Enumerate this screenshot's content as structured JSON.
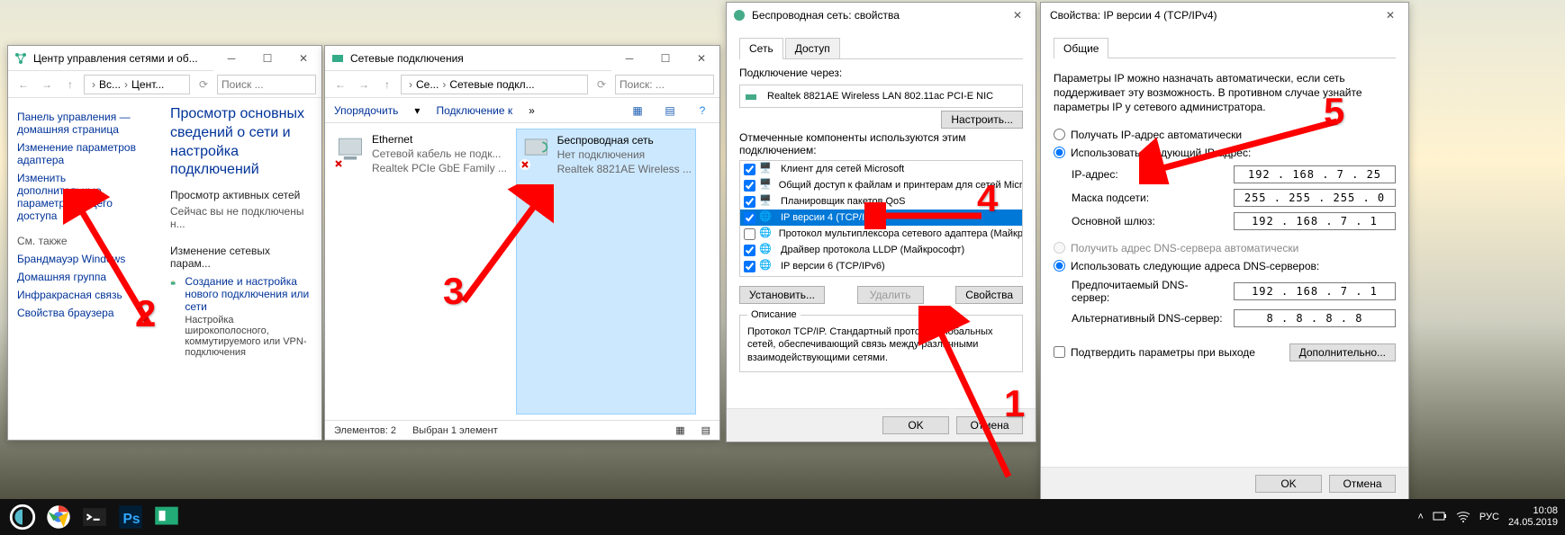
{
  "win1": {
    "title": "Центр управления сетями и об...",
    "crumb1": "Вс...",
    "crumb2": "Цент...",
    "search_ph": "Поиск ...",
    "side_home": "Панель управления — домашняя страница",
    "side_adapter": "Изменение параметров адаптера",
    "side_sharing": "Изменить дополнительные параметры общего доступа",
    "side_see_also": "См. также",
    "side_fw": "Брандмауэр Windows",
    "side_hg": "Домашняя группа",
    "side_ir": "Инфракрасная связь",
    "side_bp": "Свойства браузера",
    "main_h1": "Просмотр основных сведений о сети и настройка подключений",
    "main_active": "Просмотр активных сетей",
    "main_noconn": "Сейчас вы не подключены н...",
    "main_change": "Изменение сетевых парам...",
    "main_newconn": "Создание и настройка нового подключения или сети",
    "main_newconn_sub": "Настройка широкополосного, коммутируемого или VPN-подключения"
  },
  "win2": {
    "title": "Сетевые подключения",
    "crumb1": "Се...",
    "crumb2": "Сетевые подкл...",
    "search_ph": "Поиск: ...",
    "organize": "Упорядочить",
    "connect_to": "Подключение к",
    "eth_name": "Ethernet",
    "eth_status": "Сетевой кабель не подк...",
    "eth_dev": "Realtek PCIe GbE Family ...",
    "wifi_name": "Беспроводная сеть",
    "wifi_status": "Нет подключения",
    "wifi_dev": "Realtek 8821AE Wireless ...",
    "status_count": "Элементов: 2",
    "status_sel": "Выбран 1 элемент"
  },
  "win3": {
    "title": "Беспроводная сеть: свойства",
    "tab_net": "Сеть",
    "tab_access": "Доступ",
    "conn_via": "Подключение через:",
    "adapter": "Realtek 8821AE Wireless LAN 802.11ac PCI-E NIC",
    "configure": "Настроить...",
    "components_lbl": "Отмеченные компоненты используются этим подключением:",
    "comps": [
      "Клиент для сетей Microsoft",
      "Общий доступ к файлам и принтерам для сетей Micr...",
      "Планировщик пакетов QoS",
      "IP версии 4 (TCP/IPv4)",
      "Протокол мультиплексора сетевого адаптера (Майкро...",
      "Драйвер протокола LLDP (Майкрософт)",
      "IP версии 6 (TCP/IPv6)"
    ],
    "install": "Установить...",
    "uninstall": "Удалить",
    "props": "Свойства",
    "desc_h": "Описание",
    "desc": "Протокол TCP/IP. Стандартный протокол глобальных сетей, обеспечивающий связь между различными взаимодействующими сетями.",
    "ok": "OK",
    "cancel": "Отмена"
  },
  "win4": {
    "title": "Свойства: IP версии 4 (TCP/IPv4)",
    "tab_general": "Общие",
    "intro": "Параметры IP можно назначать автоматически, если сеть поддерживает эту возможность. В противном случае узнайте параметры IP у сетевого администратора.",
    "auto_ip": "Получать IP-адрес автоматически",
    "manual_ip": "Использовать следующий IP-адрес:",
    "ip_lbl": "IP-адрес:",
    "ip_val": "192 . 168 .  7  . 25",
    "mask_lbl": "Маска подсети:",
    "mask_val": "255 . 255 . 255 .  0",
    "gw_lbl": "Основной шлюз:",
    "gw_val": "192 . 168 .  7  .  1",
    "auto_dns": "Получить адрес DNS-сервера автоматически",
    "manual_dns": "Использовать следующие адреса DNS-серверов:",
    "dns1_lbl": "Предпочитаемый DNS-сервер:",
    "dns1_val": "192 . 168 .  7  .  1",
    "dns2_lbl": "Альтернативный DNS-сервер:",
    "dns2_val": " 8  .  8  .  8  .  8",
    "validate": "Подтвердить параметры при выходе",
    "advanced": "Дополнительно...",
    "ok": "OK",
    "cancel": "Отмена"
  },
  "taskbar": {
    "lang": "РУС",
    "time": "10:08",
    "date": "24.05.2019"
  },
  "ann": {
    "n1": "1",
    "n2": "2",
    "n3": "3",
    "n4": "4",
    "n5": "5"
  }
}
